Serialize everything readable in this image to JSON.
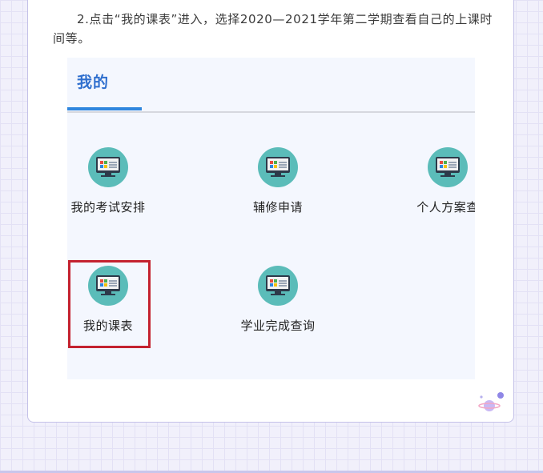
{
  "intro_text": "2.点击“我的课表”进入，选择2020—2021学年第二学期查看自己的上课时间等。",
  "screenshot": {
    "tab_title": "我的",
    "menu_items": [
      {
        "label": "我的考试安排",
        "icon": "computer-icon"
      },
      {
        "label": "辅修申请",
        "icon": "computer-icon"
      },
      {
        "label": "个人方案查",
        "icon": "computer-icon"
      },
      {
        "label": "我的课表",
        "icon": "computer-icon",
        "highlighted": true
      },
      {
        "label": "学业完成查询",
        "icon": "computer-icon"
      }
    ]
  },
  "colors": {
    "accent": "#2f6fce",
    "highlight": "#c4222f",
    "icon_bg": "#5bbcb9"
  }
}
